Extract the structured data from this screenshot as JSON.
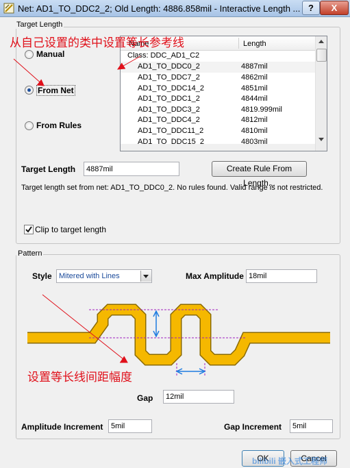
{
  "window": {
    "title": "Net: AD1_TO_DDC2_2;  Old Length: 4886.858mil  - Interactive Length ...",
    "help_label": "?",
    "close_label": "X"
  },
  "target_length_group": {
    "label": "Target Length",
    "annotation": "从自己设置的类中设置等长参考线",
    "radios": [
      {
        "label": "Manual",
        "checked": false
      },
      {
        "label": "From Net",
        "checked": true
      },
      {
        "label": "From Rules",
        "checked": false
      }
    ],
    "list": {
      "col_name": "Name",
      "col_length": "Length",
      "class_row": "Class: DDC_AD1_C2",
      "rows": [
        {
          "name": "AD1_TO_DDC0_2",
          "length": "4887mil"
        },
        {
          "name": "AD1_TO_DDC7_2",
          "length": "4862mil"
        },
        {
          "name": "AD1_TO_DDC14_2",
          "length": "4851mil"
        },
        {
          "name": "AD1_TO_DDC1_2",
          "length": "4844mil"
        },
        {
          "name": "AD1_TO_DDC3_2",
          "length": "4819.999mil"
        },
        {
          "name": "AD1_TO_DDC4_2",
          "length": "4812mil"
        },
        {
          "name": "AD1_TO_DDC11_2",
          "length": "4810mil"
        },
        {
          "name": "AD1_TO_DDC15_2",
          "length": "4803mil"
        }
      ]
    },
    "target_length_label": "Target Length",
    "target_length_value": "4887mil",
    "create_rule_button": "Create Rule From Length...",
    "info_text": "Target length set from net: AD1_TO_DDC0_2.  No rules found. Valid range is not restricted.",
    "clip_label": "Clip to target length",
    "clip_checked": true
  },
  "pattern_group": {
    "label": "Pattern",
    "style_label": "Style",
    "style_value": "Mitered with Lines",
    "max_amplitude_label": "Max Amplitude",
    "max_amplitude_value": "18mil",
    "annotation": "设置等长线间距幅度",
    "gap_label": "Gap",
    "gap_value": "12mil",
    "amplitude_increment_label": "Amplitude Increment",
    "amplitude_increment_value": "5mil",
    "gap_increment_label": "Gap Increment",
    "gap_increment_value": "5mil"
  },
  "footer": {
    "ok_label": "OK",
    "cancel_label": "Cancel",
    "watermark": "bilibili 嵌入式工程师"
  },
  "colors": {
    "trace": "#f5b800",
    "trace_edge": "#8a6a00",
    "annotation": "#e0101a",
    "arrow_blue": "#1e7be0",
    "guide_purple": "#a020c0"
  }
}
